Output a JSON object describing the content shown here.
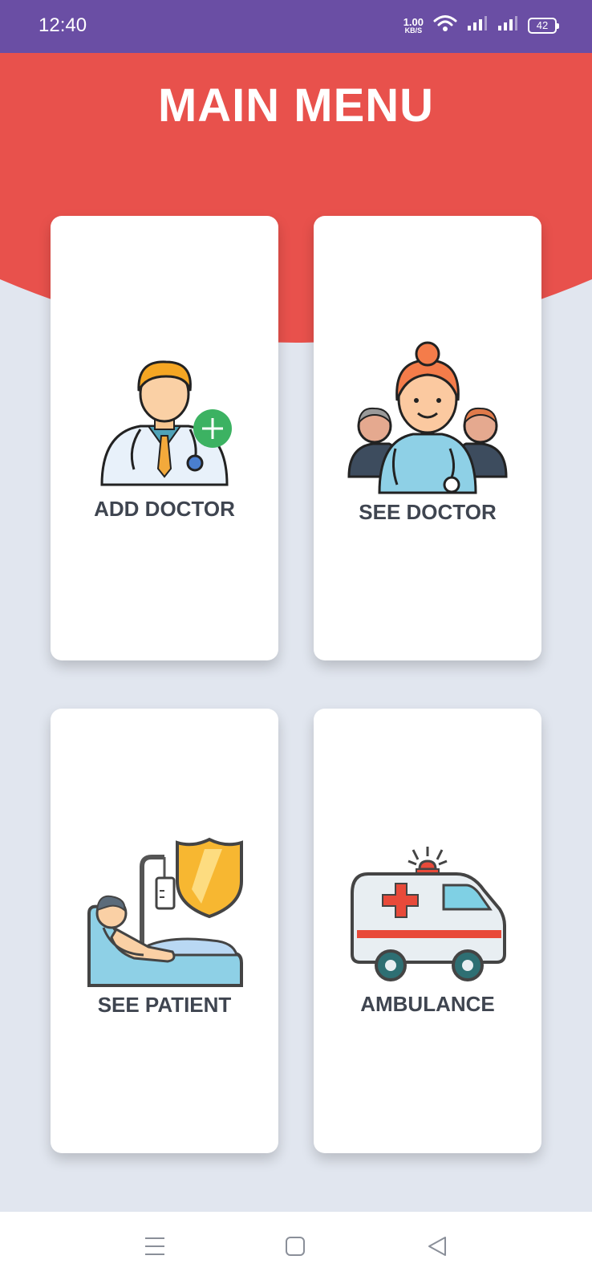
{
  "status_bar": {
    "time": "12:40",
    "net_speed_value": "1.00",
    "net_speed_unit": "KB/S",
    "battery_level": "42"
  },
  "header": {
    "title": "MAIN MENU",
    "color": "#e8514c"
  },
  "menu": [
    {
      "label": "ADD DOCTOR",
      "icon": "add-doctor-icon"
    },
    {
      "label": "SEE DOCTOR",
      "icon": "doctors-team-icon"
    },
    {
      "label": "SEE PATIENT",
      "icon": "patient-bed-icon"
    },
    {
      "label": "AMBULANCE",
      "icon": "ambulance-icon"
    }
  ],
  "nav": {
    "items": [
      "recent-apps-icon",
      "home-icon",
      "back-icon"
    ]
  },
  "colors": {
    "status_bar": "#6a4ea4",
    "background": "#e1e6ef",
    "card": "#ffffff",
    "label_text": "#3f4550"
  }
}
